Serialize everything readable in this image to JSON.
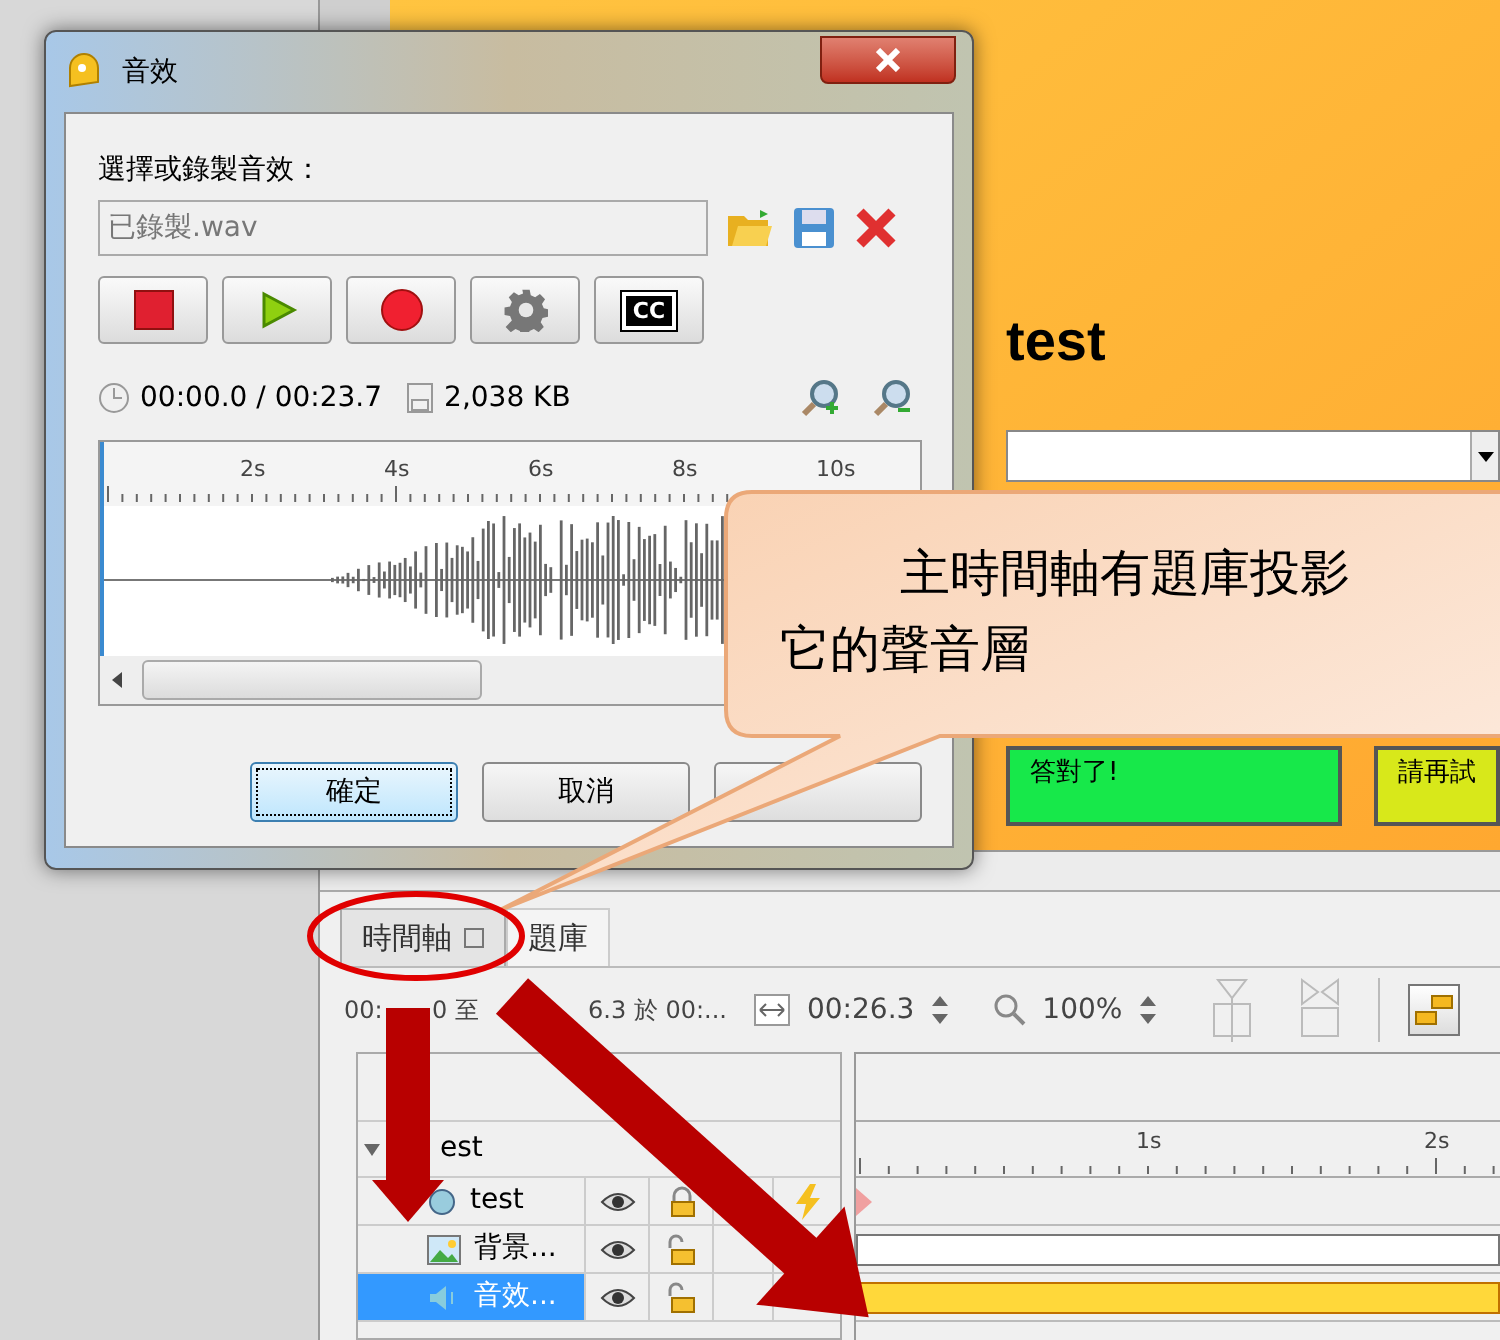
{
  "dialog": {
    "title": "音效",
    "prompt": "選擇或錄製音效：",
    "file": {
      "value": "已錄製.wav"
    },
    "transport_buttons": [
      {
        "kind": "stop"
      },
      {
        "kind": "play"
      },
      {
        "kind": "record"
      },
      {
        "kind": "settings"
      },
      {
        "kind": "captions",
        "label": "CC"
      }
    ],
    "time": "00:00.0 / 00:23.7",
    "size": "2,038 KB",
    "ruler_labels": [
      "2s",
      "4s",
      "6s",
      "8s",
      "10s"
    ],
    "buttons": [
      {
        "label": "確定",
        "default": true
      },
      {
        "label": "取消",
        "default": false
      },
      {
        "default": false
      }
    ]
  },
  "stage": {
    "title": "test",
    "answers": [
      {
        "label": "答對了!",
        "color": "#17e84a"
      },
      {
        "label": "請再試",
        "color": "#d8e81a"
      }
    ]
  },
  "callout": {
    "lines": [
      "主時間軸有題庫投影",
      "它的聲音層"
    ]
  },
  "timeline": {
    "tabs": [
      {
        "label": "時間軸",
        "selected": true
      },
      {
        "label": "題庫",
        "selected": false
      }
    ],
    "range_parts": [
      "00:",
      "0 至",
      "6.3 於 00:..."
    ],
    "duration": "00:26.3",
    "zoom": "100%",
    "ruler_labels": [
      "1s",
      "2s"
    ],
    "group": {
      "name": "est",
      "expanded": true,
      "children": [
        {
          "name": "test",
          "kind": "text",
          "selected": false,
          "locked": true,
          "has_action": true
        },
        {
          "name": "背景...",
          "kind": "image",
          "selected": false,
          "locked": false,
          "has_action": false
        },
        {
          "name": "音效...",
          "kind": "audio",
          "selected": true,
          "locked": false,
          "has_action": false
        }
      ]
    }
  }
}
